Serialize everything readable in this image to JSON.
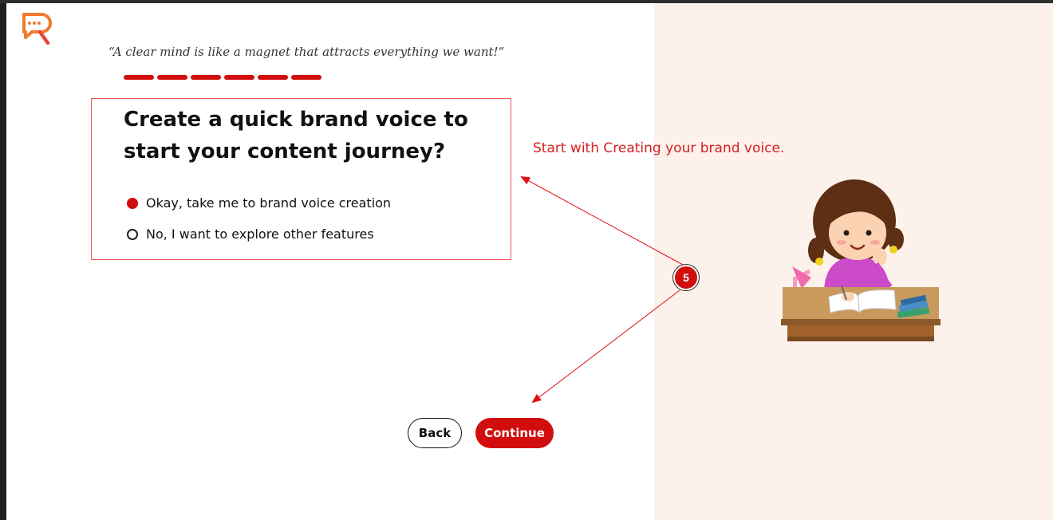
{
  "quote": "“A clear mind is like a magnet that attracts everything we want!“",
  "progress": {
    "completed_steps": 6
  },
  "question": {
    "title": "Create a quick brand voice to start your content journey?",
    "options": [
      {
        "label": "Okay, take me to brand voice creation",
        "selected": true
      },
      {
        "label": "No, I want to explore other features",
        "selected": false
      }
    ]
  },
  "annotation": {
    "text": "Start with Creating your brand voice.",
    "step_number": "5",
    "color": "#d42020"
  },
  "buttons": {
    "back": "Back",
    "continue": "Continue"
  },
  "colors": {
    "accent": "#d20d0d",
    "right_panel": "#fdf1ec"
  },
  "icons": {
    "logo": "chat-r-logo-icon",
    "illustration": "girl-studying-illustration"
  }
}
